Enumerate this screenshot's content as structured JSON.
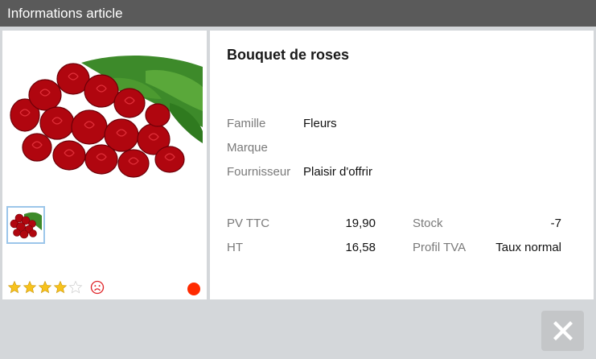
{
  "window": {
    "title": "Informations article"
  },
  "product": {
    "name": "Bouquet de roses",
    "details": [
      {
        "label": "Famille",
        "value": "Fleurs"
      },
      {
        "label": "Marque",
        "value": ""
      },
      {
        "label": "Fournisseur",
        "value": "Plaisir d'offrir"
      }
    ],
    "pricing": {
      "pv_ttc_label": "PV TTC",
      "pv_ttc_value": "19,90",
      "ht_label": "HT",
      "ht_value": "16,58",
      "stock_label": "Stock",
      "stock_value": "-7",
      "profil_tva_label": "Profil TVA",
      "profil_tva_value": "Taux normal"
    },
    "rating": {
      "value": 4,
      "max": 5
    },
    "status_color": "#ff2a00",
    "image": "red-roses-bouquet",
    "thumbnail": "red-roses-bouquet-thumbnail"
  },
  "icons": {
    "star_filled_color": "#f7c21c",
    "star_empty_color": "#d8d8d8",
    "dislike": "frown-icon",
    "close": "close-icon"
  }
}
